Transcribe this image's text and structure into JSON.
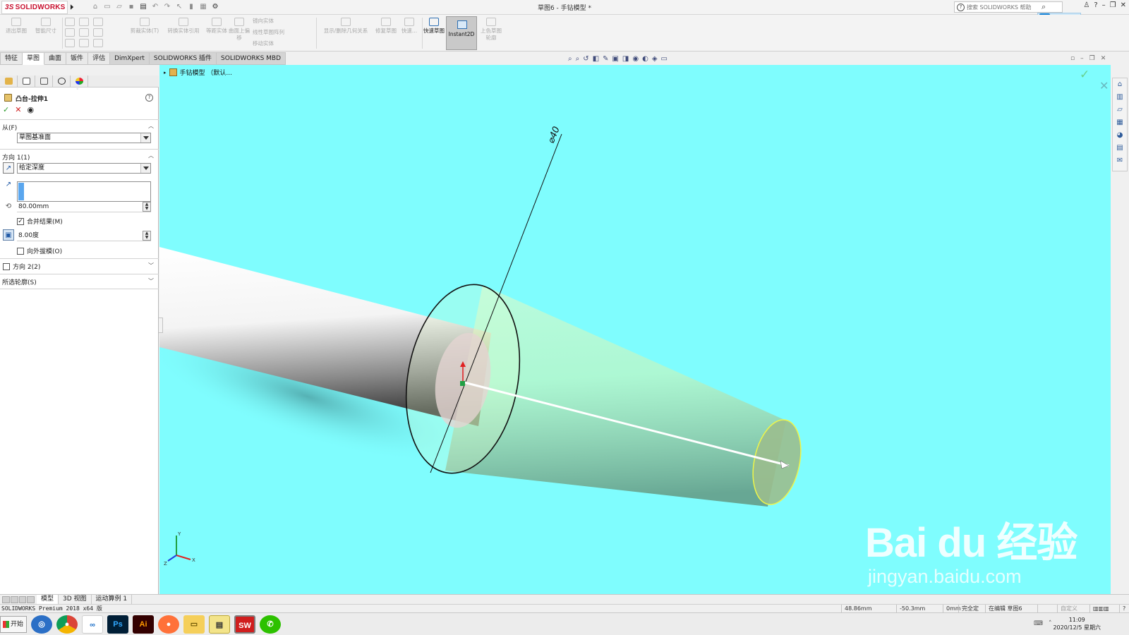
{
  "app": {
    "brand": "SOLIDWORKS",
    "brand_prefix": "3S",
    "doc_title": "草图6 - 手钻模型 *",
    "search_placeholder": "搜索 SOLIDWORKS 帮助"
  },
  "ribbon": {
    "items": [
      {
        "label": "退出草图"
      },
      {
        "label": "智能尺寸"
      },
      {
        "label": "剪裁实体(T)"
      },
      {
        "label": "转换实体引用"
      },
      {
        "label": "等距实体"
      },
      {
        "label": "曲面上偏移"
      },
      {
        "label": "镜向实体"
      },
      {
        "label": "线性草图阵列"
      },
      {
        "label": "移动实体"
      },
      {
        "label": "显示/删除几何关系"
      },
      {
        "label": "修复草图"
      },
      {
        "label": "快速..."
      },
      {
        "label": "快速草图"
      },
      {
        "label": "Instant2D"
      },
      {
        "label": "上色草图轮廓"
      }
    ]
  },
  "tabs": [
    "特征",
    "草图",
    "曲面",
    "钣件",
    "评估",
    "DimXpert",
    "SOLIDWORKS 插件",
    "SOLIDWORKS MBD"
  ],
  "active_tab": "草图",
  "property_manager": {
    "title": "凸台-拉伸1",
    "from": {
      "header": "从(F)",
      "value": "草图基准面"
    },
    "direction1": {
      "header": "方向 1(1)",
      "end_condition": "给定深度",
      "depth": "80.00mm",
      "merge_label": "合并结果(M)",
      "merge_checked": true,
      "draft_angle": "8.00度",
      "draft_outward_label": "向外拔模(O)",
      "draft_outward_checked": false
    },
    "direction2": {
      "header": "方向 2(2)",
      "checked": false
    },
    "contours": {
      "header": "所选轮廓(S)"
    }
  },
  "viewport": {
    "tree_flyout": "手钻模型 （默认...",
    "dimension_label": "⌀40",
    "background": "#7ffdfe"
  },
  "bottom_tabs": [
    "模型",
    "3D 视图",
    "运动算例 1"
  ],
  "status": {
    "product": "SOLIDWORKS Premium 2018 x64 版",
    "coord1": "48.86mm",
    "coord2": "-50.3mm",
    "coord3": "0mm",
    "definition": "完全定义",
    "editing": "在编辑 草图6",
    "custom": "自定义"
  },
  "taskbar": {
    "start": "开始",
    "apps": [
      "browser-icon",
      "chrome-icon",
      "baidu-netdisk-icon",
      "Ps",
      "Ai",
      "firefox-icon",
      "explorer-icon",
      "notepad-icon",
      "SW",
      "wechat-icon"
    ],
    "time": "11:09",
    "date": "2020/12/5 星期六"
  },
  "watermark": {
    "brand": "Bai du 经验",
    "url": "jingyan.baidu.com"
  }
}
